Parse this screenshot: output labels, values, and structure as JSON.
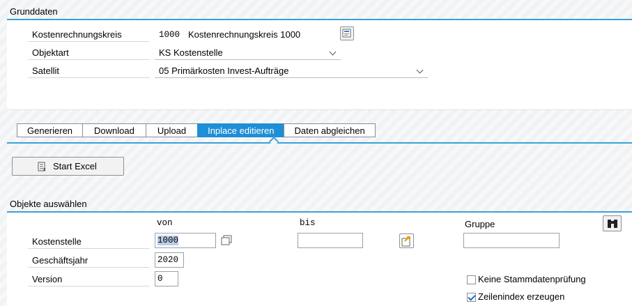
{
  "grunddaten": {
    "title": "Grunddaten",
    "fields": [
      {
        "label": "Kostenrechnungskreis",
        "code": "1000",
        "text": "Kostenrechnungskreis 1000"
      },
      {
        "label": "Objektart",
        "value": "KS Kostenstelle"
      },
      {
        "label": "Satellit",
        "value": "05 Primärkosten Invest-Aufträge"
      }
    ]
  },
  "tabs": [
    "Generieren",
    "Download",
    "Upload",
    "Inplace editieren",
    "Daten abgleichen"
  ],
  "active_tab": "Inplace editieren",
  "start_excel_label": "Start Excel",
  "objekte": {
    "title": "Objekte auswählen",
    "col_von": "von",
    "col_bis": "bis",
    "col_gruppe": "Gruppe",
    "rows": [
      {
        "label": "Kostenstelle",
        "von": "1000",
        "bis": ""
      },
      {
        "label": "Geschäftsjahr",
        "von": "2020"
      },
      {
        "label": "Version",
        "von": "0"
      }
    ],
    "gruppe_value": "",
    "keine_stammdaten_label": "Keine Stammdatenprüfung",
    "keine_stammdaten_checked": false,
    "zeilenindex_label": "Zeilenindex erzeugen",
    "zeilenindex_checked": true
  },
  "colors": {
    "accent": "#1e8fd6",
    "rule": "#3aa1d9"
  }
}
